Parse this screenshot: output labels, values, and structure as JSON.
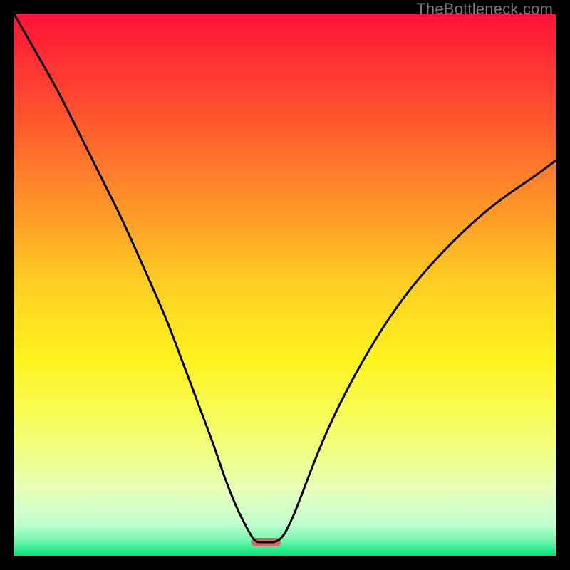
{
  "watermark": {
    "text": "TheBottleneck.com"
  },
  "chart_data": {
    "type": "line",
    "title": "",
    "xlabel": "",
    "ylabel": "",
    "xlim": [
      0,
      100
    ],
    "ylim": [
      0,
      100
    ],
    "grid": false,
    "legend": false,
    "background_gradient": {
      "stops": [
        {
          "pos": 0.0,
          "color": "#ff1238"
        },
        {
          "pos": 0.16,
          "color": "#ff4a2f"
        },
        {
          "pos": 0.33,
          "color": "#ff8b29"
        },
        {
          "pos": 0.5,
          "color": "#ffcf22"
        },
        {
          "pos": 0.64,
          "color": "#fff31f"
        },
        {
          "pos": 0.78,
          "color": "#f3ff6f"
        },
        {
          "pos": 0.88,
          "color": "#e6ffba"
        },
        {
          "pos": 0.94,
          "color": "#c2ffd0"
        },
        {
          "pos": 0.97,
          "color": "#7bf7b1"
        },
        {
          "pos": 1.0,
          "color": "#00e27a"
        }
      ]
    },
    "notch": {
      "x_center": 46.5,
      "width": 5.5,
      "y": 2.5,
      "color": "#cf6a6b"
    },
    "series": [
      {
        "name": "curve",
        "color": "#000000",
        "x": [
          0,
          4,
          8,
          12,
          16,
          20,
          24,
          28,
          31,
          34,
          37,
          39,
          41,
          43,
          44.5,
          46,
          49,
          51,
          53,
          56,
          60,
          66,
          72,
          78,
          84,
          90,
          96,
          100
        ],
        "values": [
          100,
          93,
          86,
          78,
          70,
          62,
          53,
          44,
          36,
          28,
          20,
          14,
          9,
          5,
          2.5,
          2.5,
          2.5,
          6,
          11,
          19,
          28,
          39,
          48,
          55,
          61,
          66,
          70,
          73
        ]
      }
    ]
  }
}
